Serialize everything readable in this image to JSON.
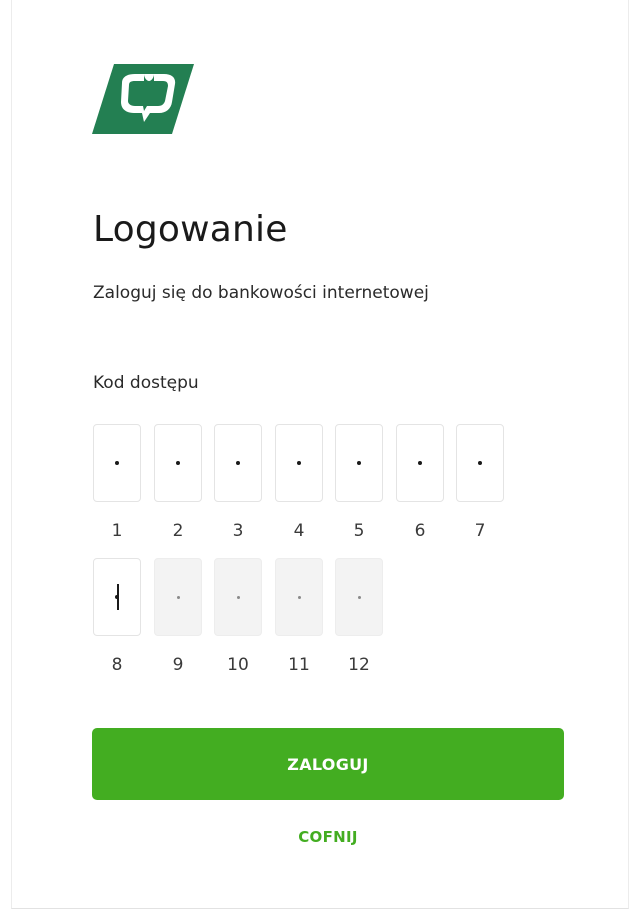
{
  "header": {
    "logo_icon": "bank-shield-logo",
    "brand_color": "#237f52"
  },
  "login": {
    "title": "Logowanie",
    "subtitle": "Zaloguj się do bankowości internetowej",
    "code_label": "Kod dostępu",
    "digits": [
      {
        "number": "1",
        "masked": "•",
        "state": "filled"
      },
      {
        "number": "2",
        "masked": "•",
        "state": "filled"
      },
      {
        "number": "3",
        "masked": "•",
        "state": "filled"
      },
      {
        "number": "4",
        "masked": "•",
        "state": "filled"
      },
      {
        "number": "5",
        "masked": "•",
        "state": "filled"
      },
      {
        "number": "6",
        "masked": "•",
        "state": "filled"
      },
      {
        "number": "7",
        "masked": "•",
        "state": "filled"
      },
      {
        "number": "8",
        "masked": "•",
        "state": "active"
      },
      {
        "number": "9",
        "masked": "•",
        "state": "disabled"
      },
      {
        "number": "10",
        "masked": "•",
        "state": "disabled"
      },
      {
        "number": "11",
        "masked": "•",
        "state": "disabled"
      },
      {
        "number": "12",
        "masked": "•",
        "state": "disabled"
      }
    ],
    "submit_label": "ZALOGUJ",
    "back_label": "COFNIJ",
    "accent_color": "#43ad21"
  }
}
